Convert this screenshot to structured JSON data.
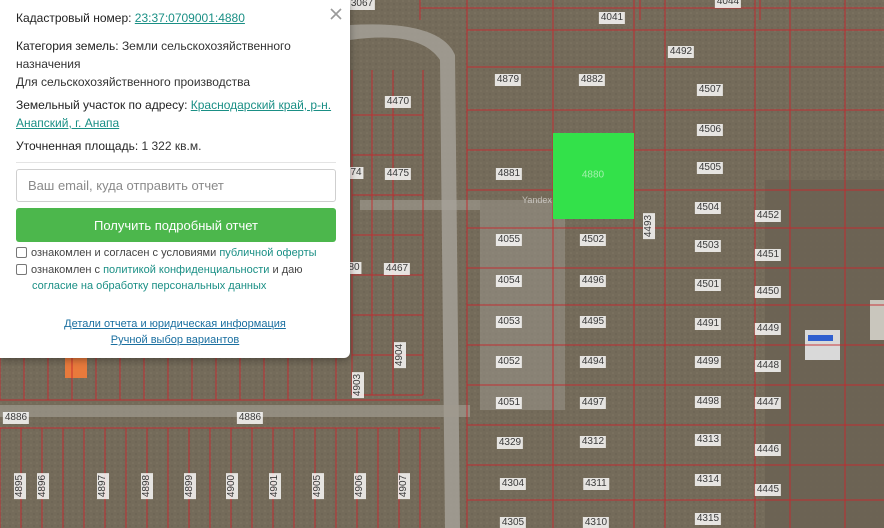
{
  "panel": {
    "cadastral_label": "Кадастровый номер:",
    "cadastral_value": "23:37:0709001:4880",
    "category_label": "Категория земель:",
    "category_value": "Земли сельскохозяйственного назначения",
    "category_use": "Для сельскохозяйственного производства",
    "address_label": "Земельный участок по адресу:",
    "address_value": "Краснодарский край, р-н. Анапский, г. Анапа",
    "area_label": "Уточненная площадь:",
    "area_value": "1 322 кв.м.",
    "email_placeholder": "Ваш email, куда отправить отчет",
    "email_value": "",
    "report_button": "Получить подробный отчет",
    "consent1_text": "ознакомлен и согласен с условиями",
    "consent1_link": "публичной оферты",
    "consent2_text_a": "ознакомлен с",
    "consent2_link_a": "политикой конфиденциальности",
    "consent2_text_b": "и даю",
    "consent2_link_b": "согласие на обработку персональных данных",
    "details_link": "Детали отчета и юридическая информация",
    "manual_link": "Ручной выбор вариантов"
  },
  "map": {
    "parcel_color": "#c8282d",
    "selected_color": "#33e14a",
    "attribution": "Yandex",
    "selected_parcel_number": "4880",
    "parcels": [
      {
        "n": "3067"
      },
      {
        "n": "4041"
      },
      {
        "n": "4044"
      },
      {
        "n": "4879"
      },
      {
        "n": "4882"
      },
      {
        "n": "4492"
      },
      {
        "n": "4507"
      },
      {
        "n": "4470"
      },
      {
        "n": "4506"
      },
      {
        "n": "4881"
      },
      {
        "n": "4505"
      },
      {
        "n": "4475"
      },
      {
        "n": "4504"
      },
      {
        "n": "4452"
      },
      {
        "n": "4055"
      },
      {
        "n": "4502"
      },
      {
        "n": "4493",
        "v": true
      },
      {
        "n": "4503"
      },
      {
        "n": "4451"
      },
      {
        "n": "4467"
      },
      {
        "n": "4054"
      },
      {
        "n": "4496"
      },
      {
        "n": "4501"
      },
      {
        "n": "4450"
      },
      {
        "n": "4053"
      },
      {
        "n": "4495"
      },
      {
        "n": "4491"
      },
      {
        "n": "4449"
      },
      {
        "n": "4052"
      },
      {
        "n": "4494"
      },
      {
        "n": "4499"
      },
      {
        "n": "4448"
      },
      {
        "n": "4903",
        "v": true
      },
      {
        "n": "4904",
        "v": true
      },
      {
        "n": "4051"
      },
      {
        "n": "4497"
      },
      {
        "n": "4498"
      },
      {
        "n": "4447"
      },
      {
        "n": "4886"
      },
      {
        "n": "4886"
      },
      {
        "n": "4329"
      },
      {
        "n": "4312"
      },
      {
        "n": "4313"
      },
      {
        "n": "4446"
      },
      {
        "n": "4895",
        "v": true
      },
      {
        "n": "4896",
        "v": true
      },
      {
        "n": "4897",
        "v": true
      },
      {
        "n": "4898",
        "v": true
      },
      {
        "n": "4899",
        "v": true
      },
      {
        "n": "4900",
        "v": true
      },
      {
        "n": "4901",
        "v": true
      },
      {
        "n": "4905",
        "v": true
      },
      {
        "n": "4906",
        "v": true
      },
      {
        "n": "4907",
        "v": true
      },
      {
        "n": "4304"
      },
      {
        "n": "4311"
      },
      {
        "n": "4314"
      },
      {
        "n": "4445"
      },
      {
        "n": "4305"
      },
      {
        "n": "4310"
      },
      {
        "n": "4315"
      },
      {
        "n": "74"
      },
      {
        "n": "80"
      }
    ]
  }
}
